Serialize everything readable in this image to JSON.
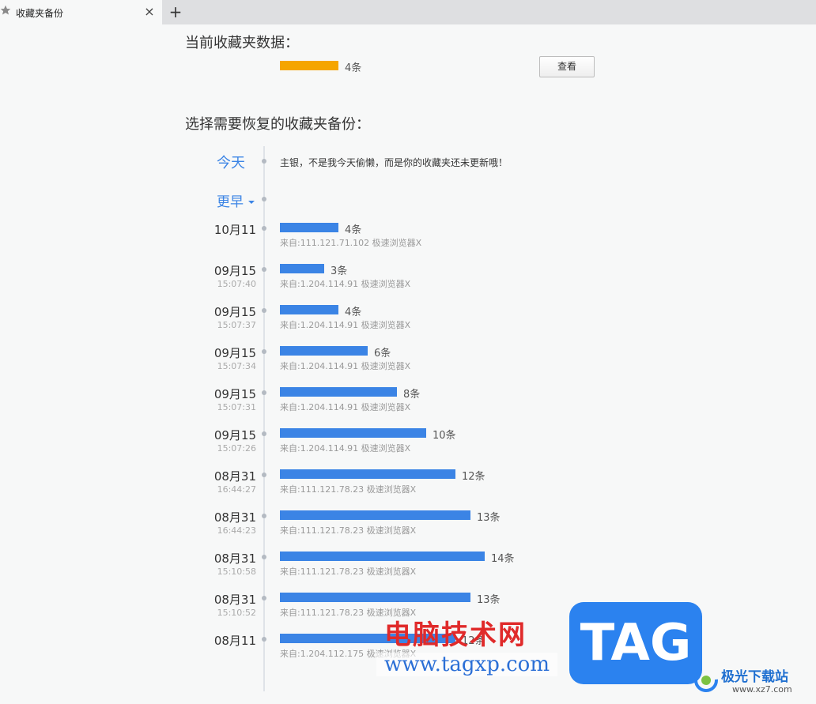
{
  "tab": {
    "title": "收藏夹备份",
    "close_glyph": "×",
    "new_tab_glyph": "+"
  },
  "current": {
    "heading": "当前收藏夹数据：",
    "count": 4,
    "count_label": "4条",
    "bar_color": "#f5a500",
    "view_button": "查看"
  },
  "backup": {
    "heading": "选择需要恢复的收藏夹备份：",
    "today_label": "今天",
    "today_message": "主银，不是我今天偷懒，而是你的收藏夹还未更新哦！",
    "earlier_label": "更早",
    "bar_color": "#3b84e5",
    "entries": [
      {
        "date": "10月11",
        "time": "",
        "count": 4,
        "count_label": "4条",
        "source": "来自:111.121.71.102 极速浏览器X"
      },
      {
        "date": "09月15",
        "time": "15:07:40",
        "count": 3,
        "count_label": "3条",
        "source": "来自:1.204.114.91 极速浏览器X"
      },
      {
        "date": "09月15",
        "time": "15:07:37",
        "count": 4,
        "count_label": "4条",
        "source": "来自:1.204.114.91 极速浏览器X"
      },
      {
        "date": "09月15",
        "time": "15:07:34",
        "count": 6,
        "count_label": "6条",
        "source": "来自:1.204.114.91 极速浏览器X"
      },
      {
        "date": "09月15",
        "time": "15:07:31",
        "count": 8,
        "count_label": "8条",
        "source": "来自:1.204.114.91 极速浏览器X"
      },
      {
        "date": "09月15",
        "time": "15:07:26",
        "count": 10,
        "count_label": "10条",
        "source": "来自:1.204.114.91 极速浏览器X"
      },
      {
        "date": "08月31",
        "time": "16:44:27",
        "count": 12,
        "count_label": "12条",
        "source": "来自:111.121.78.23 极速浏览器X"
      },
      {
        "date": "08月31",
        "time": "16:44:23",
        "count": 13,
        "count_label": "13条",
        "source": "来自:111.121.78.23 极速浏览器X"
      },
      {
        "date": "08月31",
        "time": "15:10:58",
        "count": 14,
        "count_label": "14条",
        "source": "来自:111.121.78.23 极速浏览器X"
      },
      {
        "date": "08月31",
        "time": "15:10:52",
        "count": 13,
        "count_label": "13条",
        "source": "来自:111.121.78.23 极速浏览器X"
      },
      {
        "date": "08月11",
        "time": "",
        "count": 12,
        "count_label": "12条",
        "source": "来自:1.204.112.175 极速浏览器X"
      }
    ]
  },
  "watermark": {
    "site_name": "电脑技术网",
    "site_url": "www.tagxp.com",
    "badge": "TAG",
    "logo_name": "极光下载站",
    "logo_url": "www.xz7.com"
  }
}
